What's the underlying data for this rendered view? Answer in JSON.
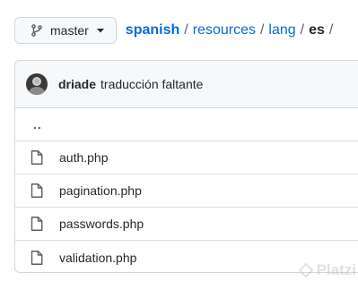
{
  "branch": {
    "icon": "git-branch-icon",
    "label": "master",
    "caret_icon": "triangle-down-icon"
  },
  "breadcrumb": {
    "repo": "spanish",
    "sep": "/",
    "parts": [
      "resources",
      "lang"
    ],
    "current": "es"
  },
  "commit": {
    "author": "driade",
    "message": "traducción faltante"
  },
  "parent_dir": "..",
  "files": [
    {
      "name": "auth.php",
      "icon": "file-icon"
    },
    {
      "name": "pagination.php",
      "icon": "file-icon"
    },
    {
      "name": "passwords.php",
      "icon": "file-icon"
    },
    {
      "name": "validation.php",
      "icon": "file-icon"
    }
  ],
  "watermark": {
    "text": "Platzi"
  },
  "colors": {
    "link": "#0969da",
    "border": "#d0d7de",
    "header_bg": "#f6f8fa",
    "text": "#24292f"
  }
}
